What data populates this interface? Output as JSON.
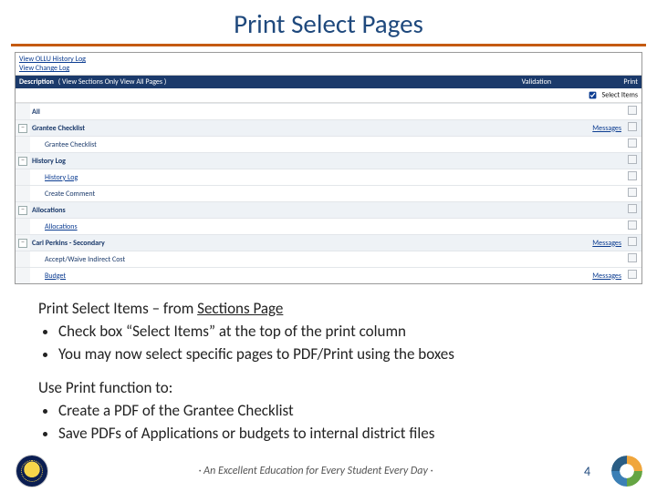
{
  "title": "Print Select Pages",
  "mini": {
    "history": [
      "View OLLU History Log",
      "View Change Log"
    ],
    "header": {
      "description": "Description",
      "subnav": "( View Sections Only  View All Pages )",
      "validation": "Validation",
      "print": "Print"
    },
    "select_items": "Select Items",
    "rows": [
      {
        "toggle": "",
        "indent": 0,
        "label": "All",
        "bold": true,
        "link": false,
        "validation": "",
        "section": false
      },
      {
        "toggle": "-",
        "indent": 0,
        "label": "Grantee Checklist",
        "bold": true,
        "link": false,
        "validation": "Messages",
        "section": true
      },
      {
        "toggle": "",
        "indent": 1,
        "label": "Grantee Checklist",
        "bold": false,
        "link": false,
        "validation": "",
        "section": false
      },
      {
        "toggle": "-",
        "indent": 0,
        "label": "History Log",
        "bold": true,
        "link": false,
        "validation": "",
        "section": true
      },
      {
        "toggle": "",
        "indent": 1,
        "label": "History Log",
        "bold": false,
        "link": true,
        "validation": "",
        "section": false
      },
      {
        "toggle": "",
        "indent": 1,
        "label": "Create Comment",
        "bold": false,
        "link": false,
        "validation": "",
        "section": false
      },
      {
        "toggle": "-",
        "indent": 0,
        "label": "Allocations",
        "bold": true,
        "link": false,
        "validation": "",
        "section": true
      },
      {
        "toggle": "",
        "indent": 1,
        "label": "Allocations",
        "bold": false,
        "link": true,
        "validation": "",
        "section": false
      },
      {
        "toggle": "-",
        "indent": 0,
        "label": "Carl Perkins - Secondary",
        "bold": true,
        "link": false,
        "validation": "Messages",
        "section": true
      },
      {
        "toggle": "",
        "indent": 1,
        "label": "Accept/Waive Indirect Cost",
        "bold": false,
        "link": false,
        "validation": "",
        "section": false
      },
      {
        "toggle": "",
        "indent": 1,
        "label": "Budget",
        "bold": false,
        "link": true,
        "validation": "Messages",
        "section": false
      }
    ]
  },
  "body": {
    "lead": [
      "Print Select Items – from ",
      "Sections Page"
    ],
    "bullets1": [
      "Check box “Select Items” at the top of the print column",
      "You may now select specific pages to PDF/Print using the boxes"
    ],
    "lead2": "Use Print function to:",
    "bullets2": [
      "Create a PDF of the Grantee Checklist",
      "Save PDFs of Applications or budgets to internal district files"
    ]
  },
  "footer": {
    "tagline": "· An Excellent Education for Every Student Every Day ·",
    "page": "4"
  }
}
